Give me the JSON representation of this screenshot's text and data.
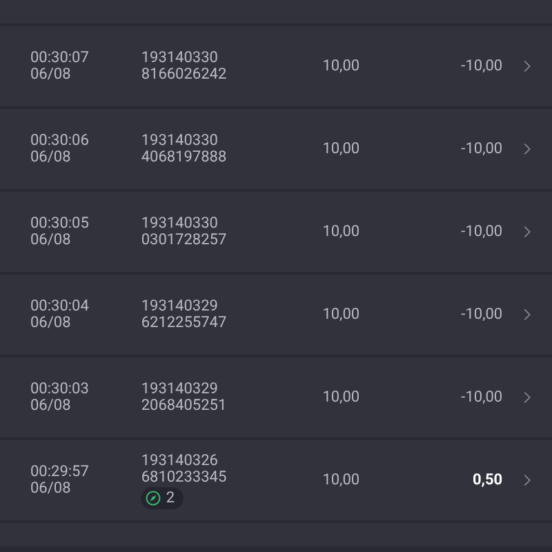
{
  "rows": [
    {
      "time": "00:30:07",
      "date": "06/08",
      "id": "193140330",
      "ref": "8166026242",
      "amount": "10,00",
      "result": "-10,00",
      "emphasized": false
    },
    {
      "time": "00:30:06",
      "date": "06/08",
      "id": "193140330",
      "ref": "4068197888",
      "amount": "10,00",
      "result": "-10,00",
      "emphasized": false
    },
    {
      "time": "00:30:05",
      "date": "06/08",
      "id": "193140330",
      "ref": "0301728257",
      "amount": "10,00",
      "result": "-10,00",
      "emphasized": false
    },
    {
      "time": "00:30:04",
      "date": "06/08",
      "id": "193140329",
      "ref": "6212255747",
      "amount": "10,00",
      "result": "-10,00",
      "emphasized": false
    },
    {
      "time": "00:30:03",
      "date": "06/08",
      "id": "193140329",
      "ref": "2068405251",
      "amount": "10,00",
      "result": "-10,00",
      "emphasized": false
    },
    {
      "time": "00:29:57",
      "date": "06/08",
      "id": "193140326",
      "ref": "6810233345",
      "badge": "2",
      "amount": "10,00",
      "result": "0,50",
      "emphasized": true
    }
  ]
}
